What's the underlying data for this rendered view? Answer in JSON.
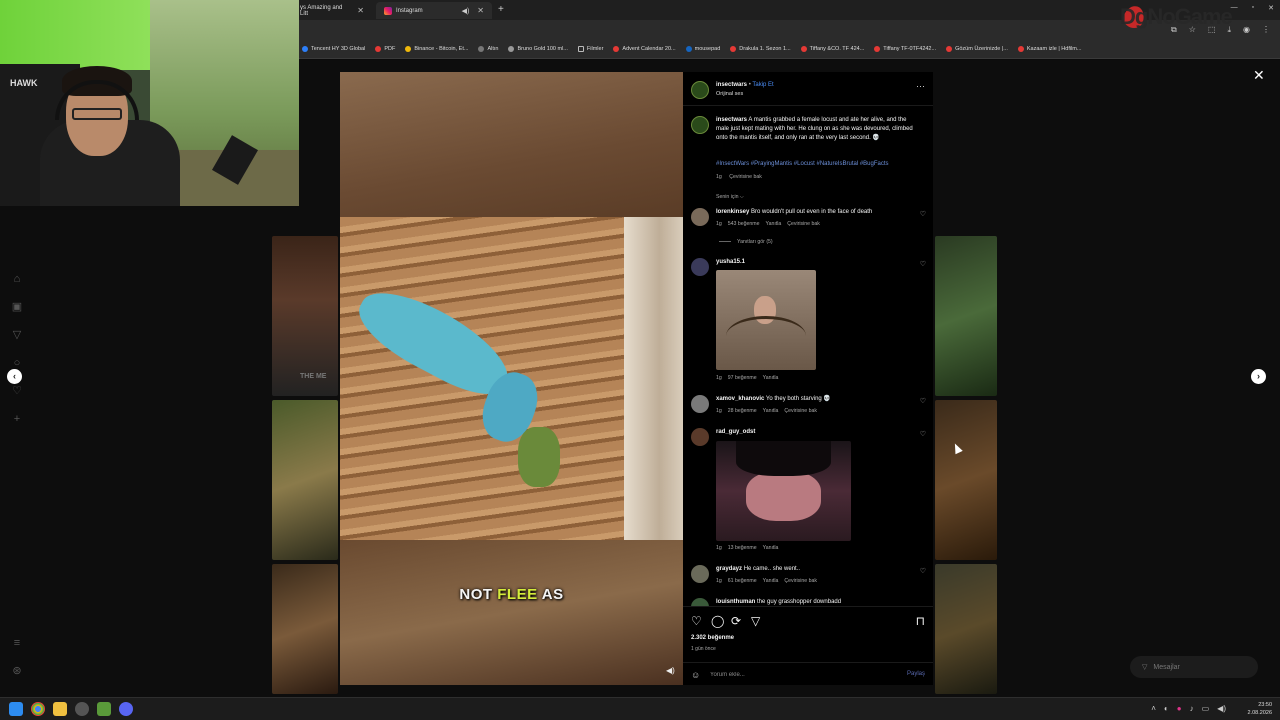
{
  "browser": {
    "tabs": [
      {
        "label": "ys Amazing and Litt",
        "active": false
      },
      {
        "label": "Instagram",
        "active": true
      }
    ],
    "bookmarks": [
      "Tencent HY 3D Global",
      "PDF",
      "Binance - Bitcoin, Et...",
      "Altın",
      "Bruno Gold 100 ml...",
      "Filmler",
      "Advent Calendar 20...",
      "mousepad",
      "Drakula 1. Sezon 1...",
      "Tiffany &CO. TF 424...",
      "Tiffany TF-0TF4242...",
      "Gözüm Üzerinizde |...",
      "Kazaam izle | Hdfilm..."
    ]
  },
  "video": {
    "caption_word1": "NOT",
    "caption_word2": "FLEE",
    "caption_word3": "AS"
  },
  "post": {
    "author": "insectwars",
    "follow_label": "Takip Et",
    "audio": "Orijinal ses",
    "caption_text": "A mantis grabbed a female locust and ate her alive, and the male just kept mating with her. He clung on as she was devoured, climbed onto the mantis itself, and only ran at the very last second. 💀",
    "hashtags": "#InsectWars #PrayingMantis #Locust #NatureIsBrutal #BugFacts",
    "time": "1g",
    "see_translation": "Çevirisine bak",
    "sort_label": "Senin için ⌵",
    "likes": "2.302 beğenme",
    "posted_ago": "1 gün önce",
    "comment_placeholder": "Yorum ekle...",
    "share_label": "Paylaş"
  },
  "comments": [
    {
      "user": "lorenkinsey",
      "text": "Bro wouldn't pull out even in the face of death",
      "time": "1g",
      "likes": "543 beğenme",
      "reply": "Yanıtla",
      "translate": "Çevirisine bak",
      "replies": "Yanıtları gör (5)"
    },
    {
      "user": "yusha15.1",
      "text": "",
      "time": "1g",
      "likes": "97 beğenme",
      "reply": "Yanıtla"
    },
    {
      "user": "xamov_khanovic",
      "text": "Yo they both starving 💀",
      "time": "1g",
      "likes": "28 beğenme",
      "reply": "Yanıtla",
      "translate": "Çevirisine bak"
    },
    {
      "user": "rad_guy_odst",
      "text": "",
      "time": "1g",
      "likes": "13 beğenme",
      "reply": "Yanıtla"
    },
    {
      "user": "graydayz",
      "text": "He came.. she went..",
      "time": "1g",
      "likes": "61 beğenme",
      "reply": "Yanıtla",
      "translate": "Çevirisine bak"
    },
    {
      "user": "louisnthuman",
      "text": "the guy grasshopper downbadd"
    }
  ],
  "messages_label": "Mesajlar",
  "watermark": "DgNoGame",
  "webcam_text": "HAWK",
  "background_text": "THE ME",
  "clock": {
    "time": "23:50",
    "date": "2.08.2026"
  }
}
